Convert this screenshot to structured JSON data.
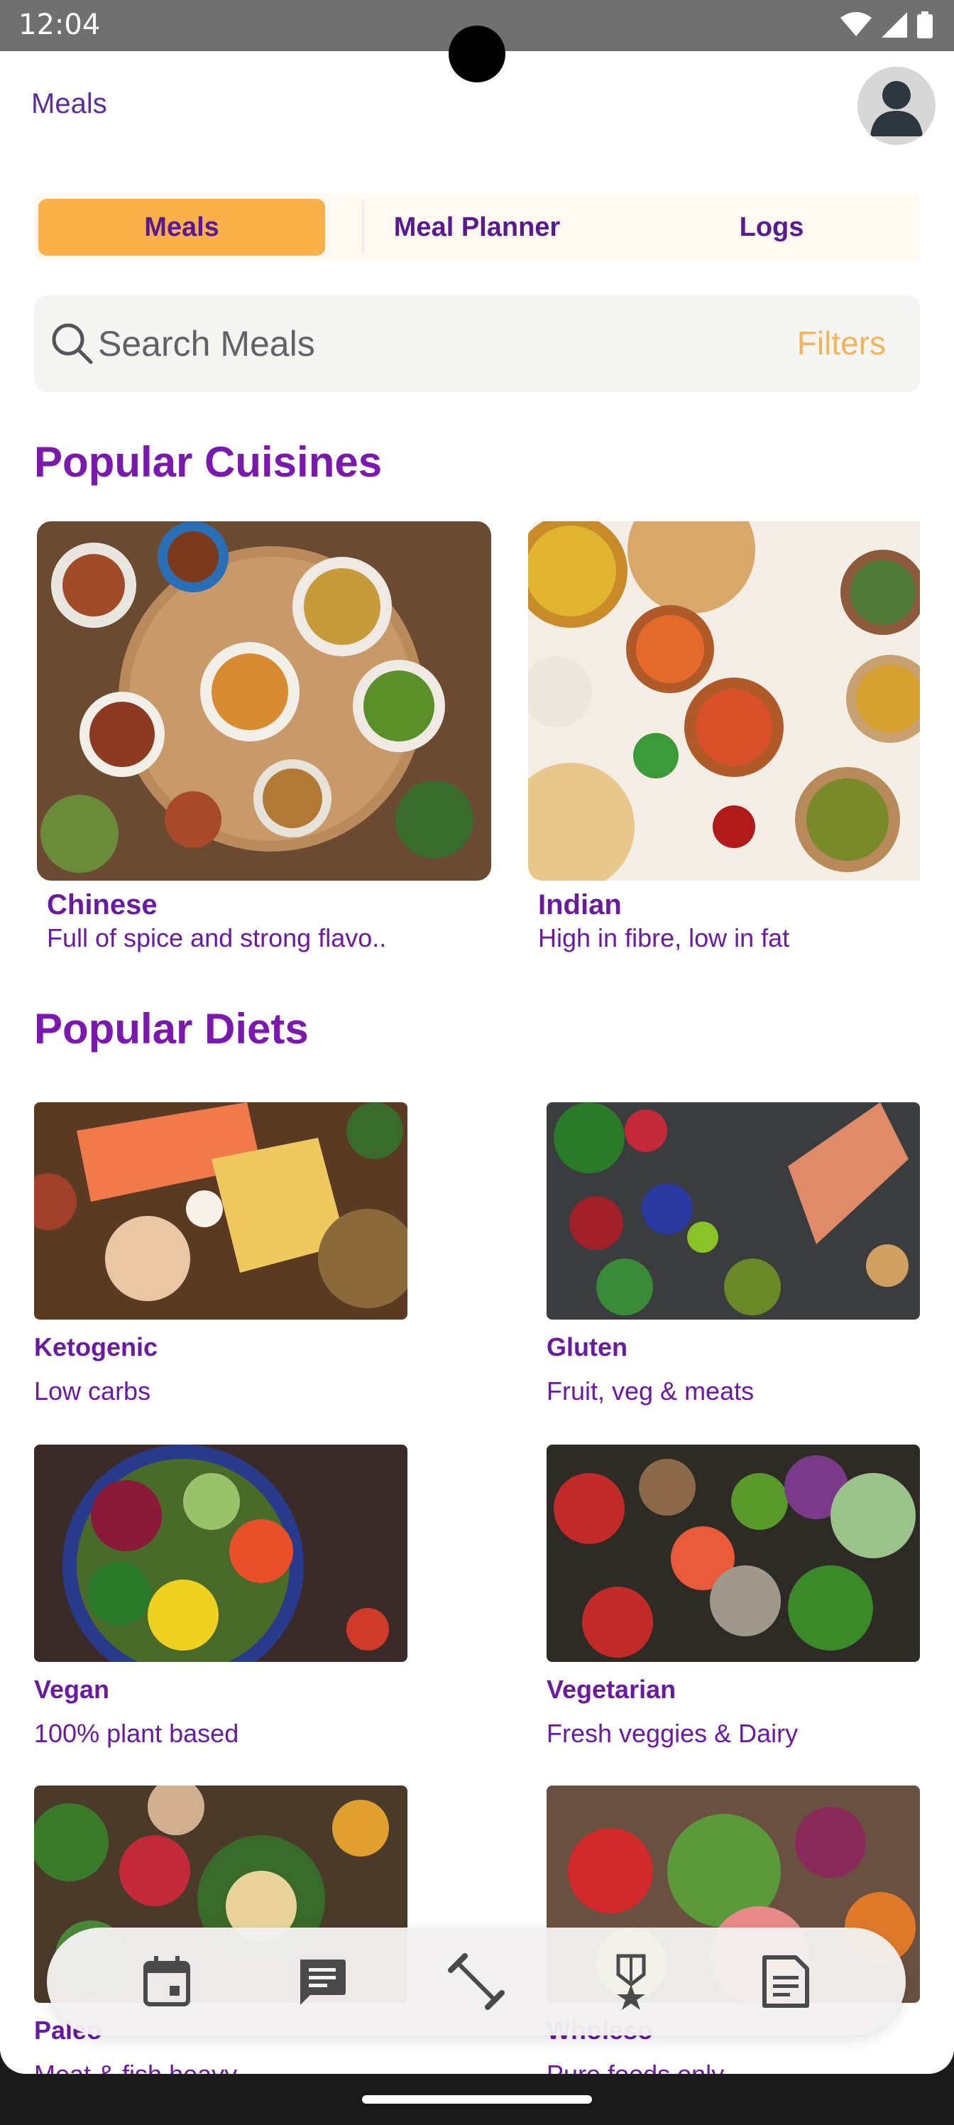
{
  "status_bar": {
    "time": "12:04"
  },
  "header": {
    "title": "Meals"
  },
  "tabs": [
    {
      "label": "Meals",
      "active": true
    },
    {
      "label": "Meal Planner",
      "active": false
    },
    {
      "label": "Logs",
      "active": false
    }
  ],
  "search": {
    "placeholder": "Search Meals",
    "filters_label": "Filters"
  },
  "sections": {
    "cuisines_title": "Popular Cuisines",
    "diets_title": "Popular Diets"
  },
  "cuisines": [
    {
      "name": "Chinese",
      "description": "Full of spice and strong flavo.."
    },
    {
      "name": "Indian",
      "description": "High in fibre, low in fat"
    }
  ],
  "diets": [
    {
      "name": "Ketogenic",
      "description": "Low carbs"
    },
    {
      "name": "Gluten",
      "description": "Fruit, veg & meats"
    },
    {
      "name": "Vegan",
      "description": "100% plant based"
    },
    {
      "name": "Vegetarian",
      "description": "Fresh veggies & Dairy"
    },
    {
      "name": "Paleo",
      "description": "Meat & fish heavy"
    },
    {
      "name": "Wholeso",
      "description": "Pure foods only"
    }
  ],
  "bottom_nav": [
    {
      "icon": "calendar-icon"
    },
    {
      "icon": "chat-icon"
    },
    {
      "icon": "dumbbell-icon"
    },
    {
      "icon": "medal-icon"
    },
    {
      "icon": "notes-icon"
    }
  ],
  "colors": {
    "accent": "#fbb04b",
    "primary_text": "#6a1aa0",
    "filters": "#f4b55a"
  }
}
